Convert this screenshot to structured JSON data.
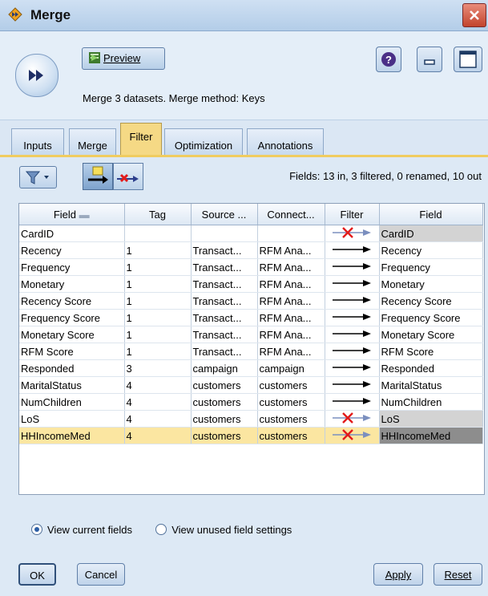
{
  "window": {
    "title": "Merge"
  },
  "header": {
    "preview_label": "Preview",
    "description": "Merge 3 datasets. Merge method: Keys"
  },
  "tabs": [
    {
      "label": "Inputs"
    },
    {
      "label": "Merge"
    },
    {
      "label": "Filter",
      "active": true
    },
    {
      "label": "Optimization"
    },
    {
      "label": "Annotations"
    }
  ],
  "filter_panel": {
    "fields_summary": "Fields: 13 in, 3 filtered, 0 renamed, 10 out",
    "columns": [
      "Field",
      "Tag",
      "Source ...",
      "Connect...",
      "Filter",
      "Field"
    ],
    "rows": [
      {
        "field": "CardID",
        "tag": "",
        "source": "",
        "connect": "",
        "filtered": true,
        "out": "CardID"
      },
      {
        "field": "Recency",
        "tag": "1",
        "source": "Transact...",
        "connect": "RFM Ana...",
        "filtered": false,
        "out": "Recency"
      },
      {
        "field": "Frequency",
        "tag": "1",
        "source": "Transact...",
        "connect": "RFM Ana...",
        "filtered": false,
        "out": "Frequency"
      },
      {
        "field": "Monetary",
        "tag": "1",
        "source": "Transact...",
        "connect": "RFM Ana...",
        "filtered": false,
        "out": "Monetary"
      },
      {
        "field": "Recency Score",
        "tag": "1",
        "source": "Transact...",
        "connect": "RFM Ana...",
        "filtered": false,
        "out": "Recency Score"
      },
      {
        "field": "Frequency Score",
        "tag": "1",
        "source": "Transact...",
        "connect": "RFM Ana...",
        "filtered": false,
        "out": "Frequency Score"
      },
      {
        "field": "Monetary Score",
        "tag": "1",
        "source": "Transact...",
        "connect": "RFM Ana...",
        "filtered": false,
        "out": "Monetary Score"
      },
      {
        "field": "RFM Score",
        "tag": "1",
        "source": "Transact...",
        "connect": "RFM Ana...",
        "filtered": false,
        "out": "RFM Score"
      },
      {
        "field": "Responded",
        "tag": "3",
        "source": "campaign",
        "connect": "campaign",
        "filtered": false,
        "out": "Responded"
      },
      {
        "field": "MaritalStatus",
        "tag": "4",
        "source": "customers",
        "connect": "customers",
        "filtered": false,
        "out": "MaritalStatus"
      },
      {
        "field": "NumChildren",
        "tag": "4",
        "source": "customers",
        "connect": "customers",
        "filtered": false,
        "out": "NumChildren"
      },
      {
        "field": "LoS",
        "tag": "4",
        "source": "customers",
        "connect": "customers",
        "filtered": true,
        "out": "LoS"
      },
      {
        "field": "HHIncomeMed",
        "tag": "4",
        "source": "customers",
        "connect": "customers",
        "filtered": true,
        "out": "HHIncomeMed",
        "selected": true
      }
    ],
    "radio_current": "View current fields",
    "radio_unused": "View unused field settings"
  },
  "buttons": {
    "ok": "OK",
    "cancel": "Cancel",
    "apply": "Apply",
    "reset": "Reset"
  },
  "icons": {
    "title": "merge-node-icon",
    "node": "merge-arrows-icon",
    "filter_arrow": "arrow-right-icon",
    "filter_blocked": "red-x-arrow-icon"
  },
  "colors": {
    "selected_row": "#fbe6a1",
    "active_tab": "#f5d985",
    "filtered_out": "#d3d3d3",
    "filter_x": "#e21b1b"
  }
}
